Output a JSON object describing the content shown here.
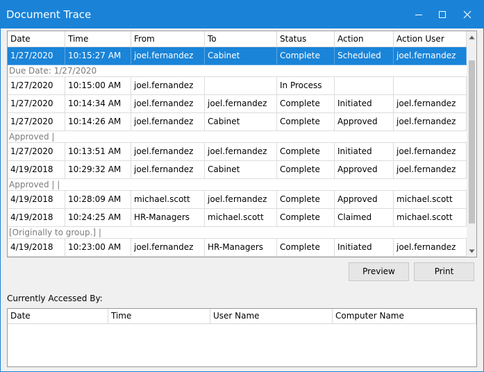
{
  "window": {
    "title": "Document Trace"
  },
  "trace": {
    "columns": [
      "Date",
      "Time",
      "From",
      "To",
      "Status",
      "Action",
      "Action User"
    ],
    "items": [
      {
        "type": "row",
        "selected": true,
        "cells": [
          "1/27/2020",
          "10:15:27 AM",
          "joel.fernandez",
          "Cabinet",
          "Complete",
          "Scheduled",
          "joel.fernandez"
        ]
      },
      {
        "type": "note",
        "text": "Due Date: 1/27/2020"
      },
      {
        "type": "row",
        "cells": [
          "1/27/2020",
          "10:15:00 AM",
          "joel.fernandez",
          "",
          "In Process",
          "",
          ""
        ]
      },
      {
        "type": "row",
        "cells": [
          "1/27/2020",
          "10:14:34 AM",
          "joel.fernandez",
          "joel.fernandez",
          "Complete",
          "Initiated",
          "joel.fernandez"
        ]
      },
      {
        "type": "row",
        "cells": [
          "1/27/2020",
          "10:14:26 AM",
          "joel.fernandez",
          "Cabinet",
          "Complete",
          "Approved",
          "joel.fernandez"
        ]
      },
      {
        "type": "note",
        "text": "Approved |"
      },
      {
        "type": "row",
        "cells": [
          "1/27/2020",
          "10:13:51 AM",
          "joel.fernandez",
          "joel.fernandez",
          "Complete",
          "Initiated",
          "joel.fernandez"
        ]
      },
      {
        "type": "row",
        "cells": [
          "4/19/2018",
          "10:29:32 AM",
          "joel.fernandez",
          "Cabinet",
          "Complete",
          "Approved",
          "joel.fernandez"
        ]
      },
      {
        "type": "note",
        "text": "Approved |  |"
      },
      {
        "type": "row",
        "cells": [
          "4/19/2018",
          "10:28:09 AM",
          "michael.scott",
          "joel.fernandez",
          "Complete",
          "Approved",
          "michael.scott"
        ]
      },
      {
        "type": "row",
        "cells": [
          "4/19/2018",
          "10:24:25 AM",
          "HR-Managers",
          "michael.scott",
          "Complete",
          "Claimed",
          "michael.scott"
        ]
      },
      {
        "type": "note",
        "text": "[Originally to group.] |"
      },
      {
        "type": "row",
        "cells": [
          "4/19/2018",
          "10:23:00 AM",
          "joel.fernandez",
          "HR-Managers",
          "Complete",
          "Initiated",
          "joel.fernandez"
        ]
      }
    ]
  },
  "buttons": {
    "preview": "Preview",
    "print": "Print"
  },
  "accessed": {
    "label": "Currently Accessed By:",
    "columns": [
      "Date",
      "Time",
      "User Name",
      "Computer Name"
    ]
  },
  "colors": {
    "titlebar": "#1a83d8",
    "selection": "#1a84d8",
    "note_text": "#7b7b7b"
  }
}
